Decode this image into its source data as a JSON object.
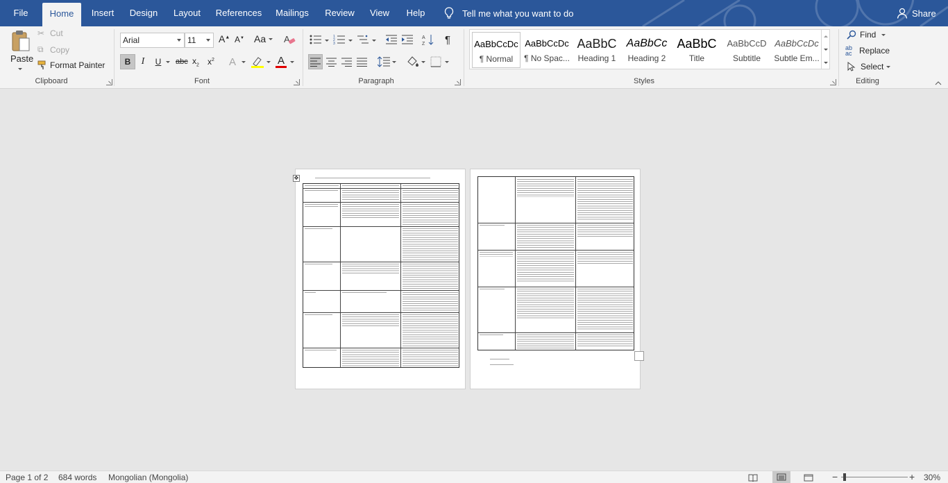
{
  "tabs": [
    "File",
    "Home",
    "Insert",
    "Design",
    "Layout",
    "References",
    "Mailings",
    "Review",
    "View",
    "Help"
  ],
  "active_tab": "Home",
  "tell_me": "Tell me what you want to do",
  "share": "Share",
  "clipboard": {
    "paste": "Paste",
    "cut": "Cut",
    "copy": "Copy",
    "format_painter": "Format Painter",
    "label": "Clipboard"
  },
  "font": {
    "name": "Arial",
    "size": "11",
    "label": "Font",
    "bold": "B",
    "italic": "I",
    "underline": "U",
    "strikethrough": "abc",
    "subscript": "x",
    "superscript": "x",
    "change_case": "Aa",
    "font_color": "A"
  },
  "paragraph": {
    "label": "Paragraph"
  },
  "styles": {
    "label": "Styles",
    "items": [
      {
        "preview": "AaBbCcDc",
        "name": "¶ Normal"
      },
      {
        "preview": "AaBbCcDc",
        "name": "¶ No Spac..."
      },
      {
        "preview": "AaBbC",
        "name": "Heading 1"
      },
      {
        "preview": "AaBbCc",
        "name": "Heading 2"
      },
      {
        "preview": "AaBbC",
        "name": "Title"
      },
      {
        "preview": "AaBbCcD",
        "name": "Subtitle"
      },
      {
        "preview": "AaBbCcDc",
        "name": "Subtle Em..."
      }
    ]
  },
  "editing": {
    "label": "Editing",
    "find": "Find",
    "replace": "Replace",
    "select": "Select"
  },
  "status": {
    "page": "Page 1 of 2",
    "words": "684 words",
    "language": "Mongolian (Mongolia)",
    "zoom": "30%"
  },
  "colors": {
    "accent": "#2b579a",
    "ribbon": "#f3f3f3",
    "canvas": "#e6e6e6"
  }
}
